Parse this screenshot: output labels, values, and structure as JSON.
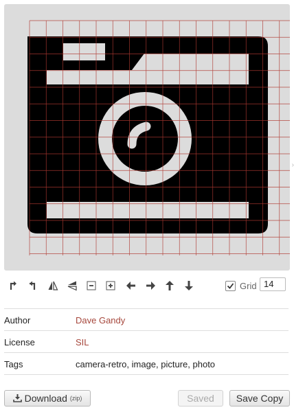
{
  "toolbar": {
    "tools": [
      {
        "name": "rotate-left-icon"
      },
      {
        "name": "rotate-right-icon"
      },
      {
        "name": "flip-horizontal-icon"
      },
      {
        "name": "flip-vertical-icon"
      },
      {
        "name": "shrink-icon"
      },
      {
        "name": "expand-icon"
      },
      {
        "name": "arrow-left-icon"
      },
      {
        "name": "arrow-right-icon"
      },
      {
        "name": "arrow-up-icon"
      },
      {
        "name": "arrow-down-icon"
      }
    ],
    "grid_label": "Grid",
    "grid_checked": true,
    "grid_size": "14"
  },
  "meta": {
    "author_label": "Author",
    "author_value": "Dave Gandy",
    "license_label": "License",
    "license_value": "SIL",
    "tags_label": "Tags",
    "tags_value": "camera-retro, image, picture, photo"
  },
  "buttons": {
    "download_label": "Download",
    "download_suffix": "(zip)",
    "saved_label": "Saved",
    "save_copy_label": "Save Copy"
  },
  "colors": {
    "canvas_bg": "#dcdcdc",
    "glyph": "#000000",
    "grid_line": "#b03a32",
    "link": "#a6473c"
  }
}
